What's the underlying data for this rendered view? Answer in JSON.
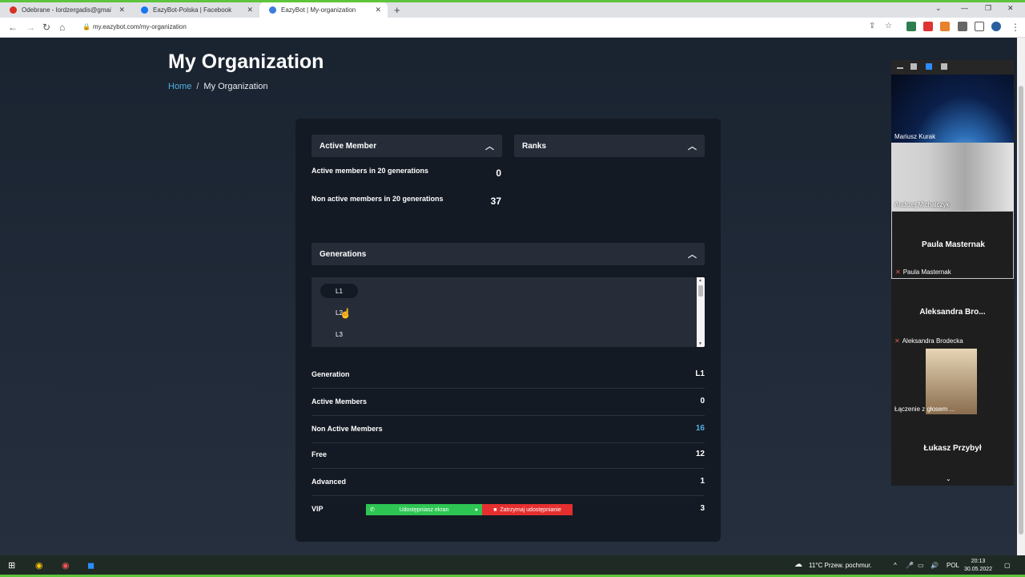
{
  "browser": {
    "tabs": [
      {
        "label": "Odebrane - lordzergadis@gmai",
        "favicon_color": "#d93025"
      },
      {
        "label": "EazyBot-Polska | Facebook",
        "favicon_color": "#1877f2"
      },
      {
        "label": "EazyBot | My-organization",
        "favicon_color": "#3b7ddd"
      }
    ],
    "new_tab": "+",
    "url": "my.eazybot.com/my-organization"
  },
  "page": {
    "title": "My Organization",
    "breadcrumb": {
      "home": "Home",
      "separator": "/",
      "current": "My Organization"
    }
  },
  "active_member": {
    "header": "Active Member",
    "rows": [
      {
        "label": "Active members in 20 generations",
        "value": "0"
      },
      {
        "label": "Non active members in 20 generations",
        "value": "37"
      }
    ]
  },
  "ranks": {
    "header": "Ranks"
  },
  "generations": {
    "header": "Generations",
    "items": [
      "L1",
      "L2",
      "L3"
    ],
    "selected": "L1"
  },
  "generation_details": [
    {
      "label": "Generation",
      "value": "L1"
    },
    {
      "label": "Active Members",
      "value": "0"
    },
    {
      "label": "Non Active Members",
      "value": "16"
    },
    {
      "label": "Free",
      "value": "12"
    },
    {
      "label": "Advanced",
      "value": "1"
    },
    {
      "label": "VIP",
      "value": "3"
    }
  ],
  "screen_share": {
    "sharing": "Udostępniasz ekran",
    "stop": "Zatrzymaj udostępnianie"
  },
  "meeting": {
    "participants": [
      {
        "name": "Mariusz Kurak",
        "video": true
      },
      {
        "name": "Andrzej Michalczyk",
        "video": true
      },
      {
        "name": "Paula Masternak",
        "big": "Paula Masternak",
        "muted": true
      },
      {
        "name": "Aleksandra Brodecka",
        "big": "Aleksandra Bro...",
        "muted": true
      },
      {
        "name": "Łączenie z głosem ...",
        "video": true
      },
      {
        "name": "Łukasz Przybył",
        "big": "Łukasz Przybył"
      }
    ]
  },
  "taskbar": {
    "weather": "11°C  Przew. pochmur.",
    "lang": "POL",
    "time": "20:13",
    "date": "30.05.2022"
  },
  "colors": {
    "accent": "#4fb1e3",
    "share_green": "#2dc653",
    "stop_red": "#e52f2f"
  }
}
